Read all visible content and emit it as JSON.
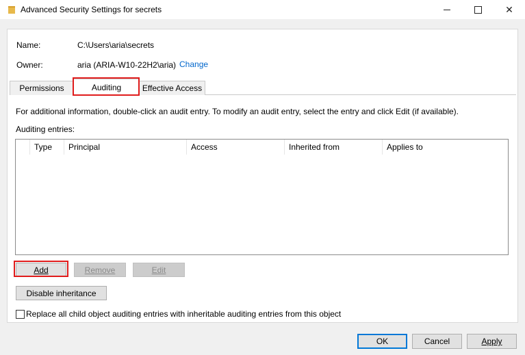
{
  "window": {
    "title": "Advanced Security Settings for secrets",
    "controls": [
      "minimize",
      "maximize",
      "close"
    ]
  },
  "info": {
    "name_label": "Name:",
    "name_value": "C:\\Users\\aria\\secrets",
    "owner_label": "Owner:",
    "owner_value": "aria (ARIA-W10-22H2\\aria)",
    "change_link": "Change"
  },
  "tabs": [
    {
      "label": "Permissions",
      "active": false
    },
    {
      "label": "Auditing",
      "active": true
    },
    {
      "label": "Effective Access",
      "active": false
    }
  ],
  "auditing": {
    "description": "For additional information, double-click an audit entry. To modify an audit entry, select the entry and click Edit (if available).",
    "entries_label": "Auditing entries:",
    "columns": [
      "Type",
      "Principal",
      "Access",
      "Inherited from",
      "Applies to"
    ],
    "rows": []
  },
  "buttons": {
    "add": "Add",
    "remove": "Remove",
    "edit": "Edit",
    "disable_inheritance": "Disable inheritance"
  },
  "replace_checkbox": {
    "label": "Replace all child object auditing entries with inheritable auditing entries from this object",
    "checked": false
  },
  "footer": {
    "ok": "OK",
    "cancel": "Cancel",
    "apply": "Apply"
  },
  "colors": {
    "link": "#0066cc",
    "highlight": "#e01b1b",
    "accent": "#0078d7"
  }
}
